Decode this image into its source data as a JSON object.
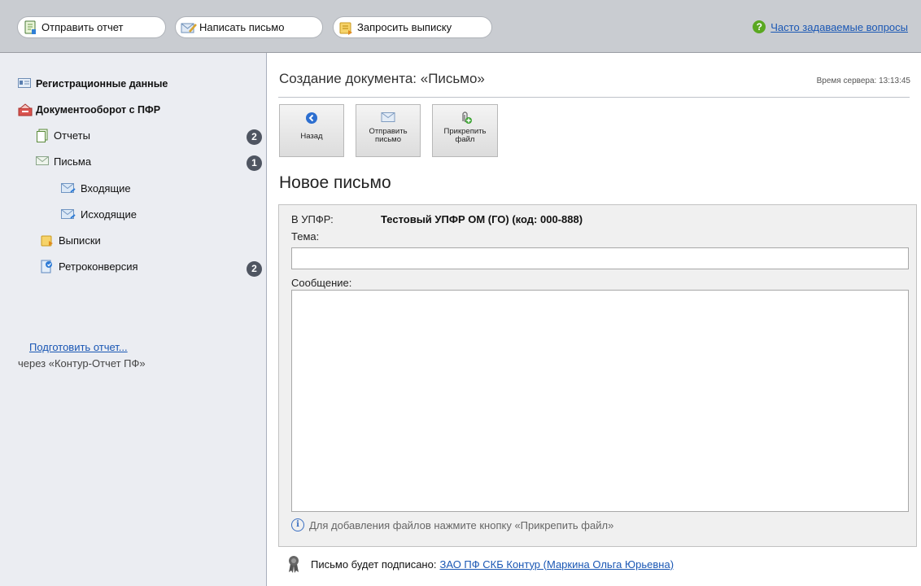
{
  "toolbar": {
    "send_report": "Отправить отчет",
    "write_letter": "Написать письмо",
    "request_statement": "Запросить выписку",
    "faq": "Часто задаваемые вопросы"
  },
  "sidebar": {
    "registration": "Регистрационные данные",
    "docflow": "Документооборот с ПФР",
    "items": [
      {
        "label": "Отчеты",
        "badge": "2"
      },
      {
        "label": "Письма",
        "badge": "1"
      },
      {
        "label": "Входящие"
      },
      {
        "label": "Исходящие"
      },
      {
        "label": "Выписки"
      },
      {
        "label": "Ретроконверсия",
        "badge": "2"
      }
    ],
    "prepare_link": "Подготовить отчет...",
    "prepare_sub": "через «Контур-Отчет ПФ»"
  },
  "main": {
    "title": "Создание документа: «Письмо»",
    "server_time": "Время сервера: 13:13:45",
    "actions": {
      "back": "Назад",
      "send_line1": "Отправить",
      "send_line2": "письмо",
      "attach_line1": "Прикрепить",
      "attach_line2": "файл"
    },
    "heading": "Новое письмо",
    "form": {
      "to_label": "В УПФР:",
      "to_value": "Тестовый УПФР ОМ (ГО) (код: 000-888)",
      "subject_label": "Тема:",
      "subject_value": "",
      "message_label": "Сообщение:",
      "message_value": "",
      "hint": "Для добавления файлов нажмите кнопку «Прикрепить файл»"
    },
    "sign_label": "Письмо будет подписано:",
    "sign_value": "ЗАО ПФ СКБ Контур (Маркина Ольга Юрьевна)"
  },
  "colors": {
    "link": "#1a57b4",
    "topbar_bg": "#c9ccd1",
    "sidebar_bg": "#ebedf2",
    "badge_bg": "#4f5561",
    "faq_icon": "#5aa821"
  }
}
